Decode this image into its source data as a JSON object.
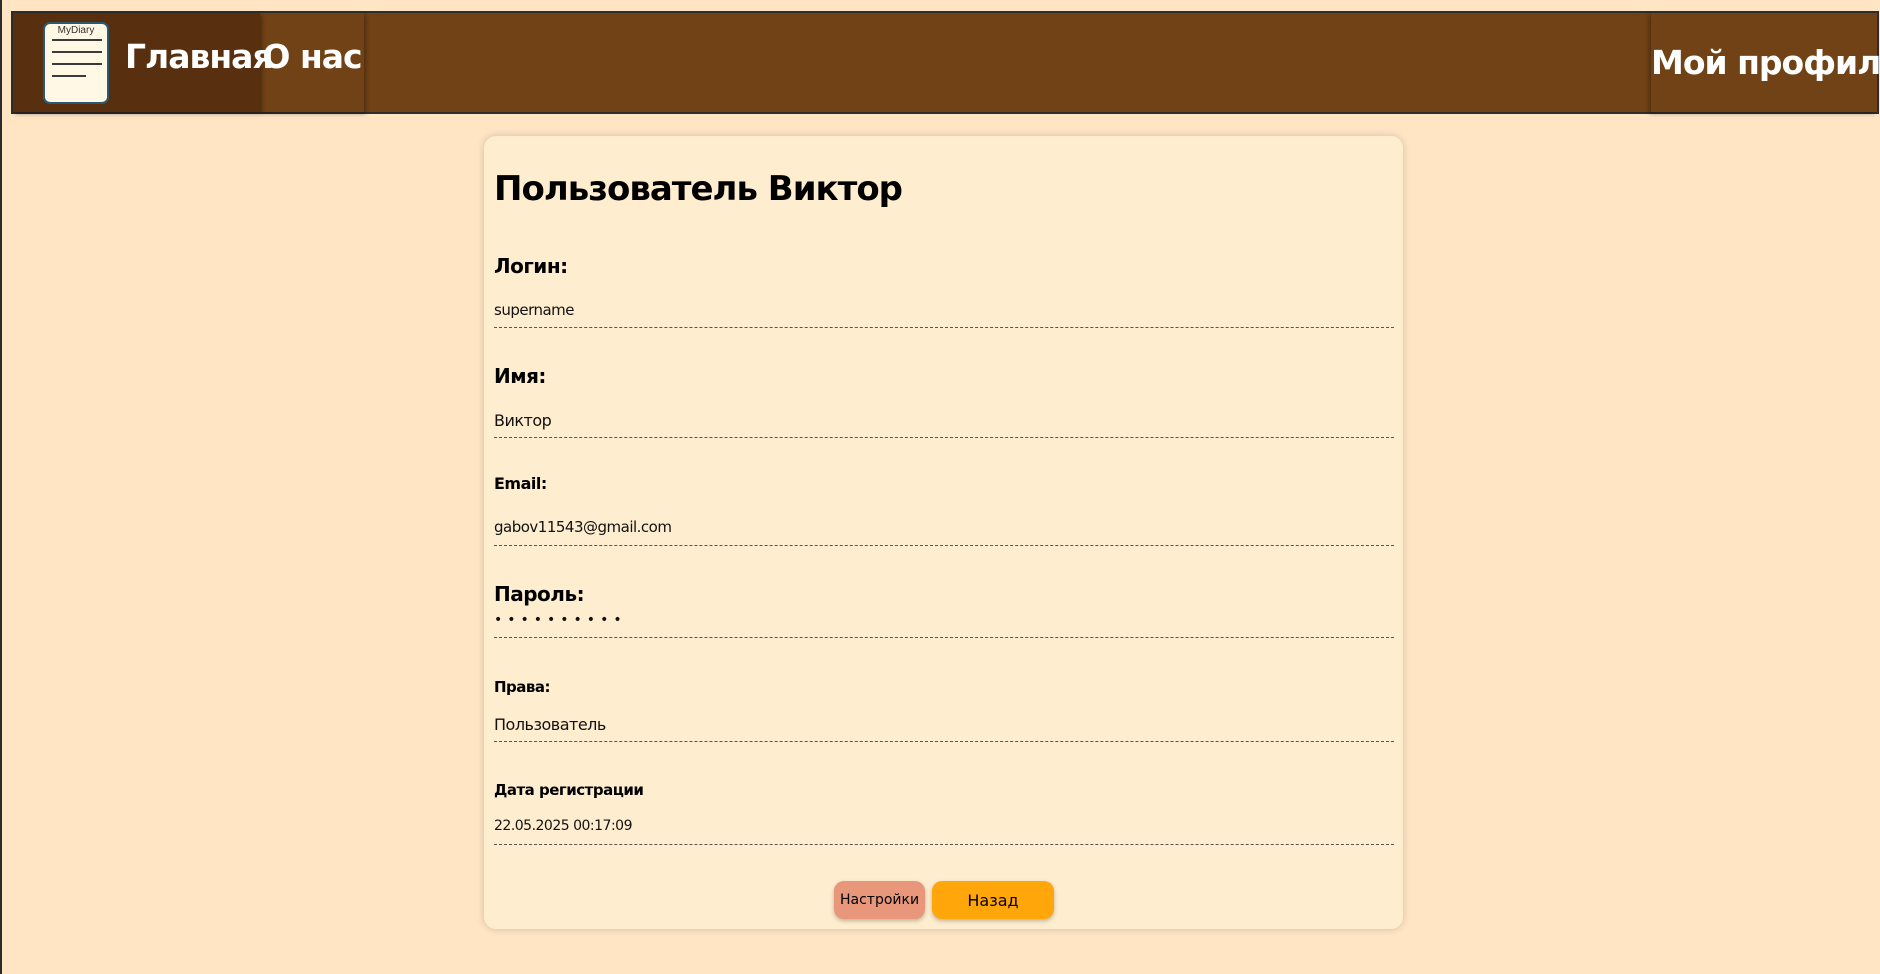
{
  "nav": {
    "logo_text": "MyDiary",
    "home_label": "Главная",
    "about_label": "О нас",
    "profile_label": "Мой профиль"
  },
  "profile": {
    "title": "Пользователь Виктор",
    "fields": [
      {
        "label": "Логин:",
        "value": "supername"
      },
      {
        "label": "Имя:",
        "value": "Виктор"
      },
      {
        "label": "Email:",
        "value": "gabov11543@gmail.com"
      },
      {
        "label": "Пароль:",
        "value": "••••••••••"
      },
      {
        "label": "Права:",
        "value": "Пользователь"
      },
      {
        "label": "Дата регистрации",
        "value": "22.05.2025 00:17:09"
      }
    ]
  },
  "buttons": {
    "settings_label": "Настройки",
    "back_label": "Назад"
  },
  "colors": {
    "page_bg": "#FFE5C4",
    "navbar_bg": "#704216",
    "nav_home_bg": "#58300F",
    "card_bg": "#FFEDCF",
    "settings_button": "#E8977B",
    "back_button": "#FFA70A"
  },
  "icons": {
    "logo": "notepad-icon"
  }
}
